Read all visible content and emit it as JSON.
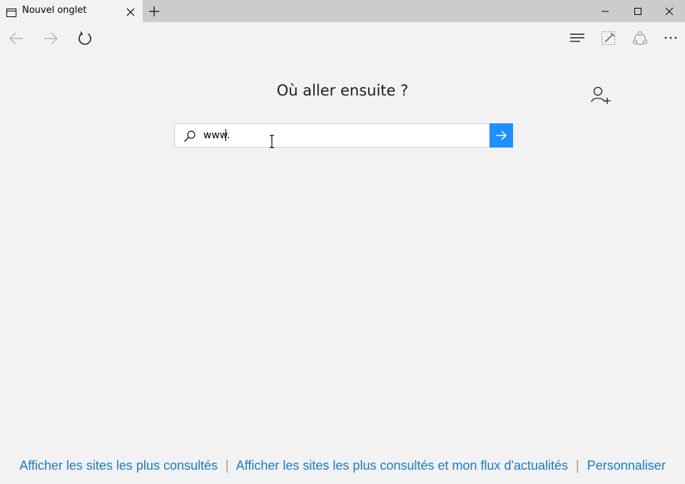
{
  "tab": {
    "title": "Nouvel onglet",
    "icon": "page-icon",
    "close_icon": "close-icon",
    "new_tab_icon": "plus-icon"
  },
  "window_controls": [
    "minimize-icon",
    "maximize-icon",
    "close-icon"
  ],
  "toolbar": {
    "left": [
      "back-arrow-icon",
      "forward-arrow-icon",
      "refresh-icon"
    ],
    "right": [
      "hub-icon",
      "web-note-icon",
      "share-icon",
      "more-icon"
    ]
  },
  "main": {
    "heading": "Où aller ensuite ?",
    "add_user_icon": "add-user-icon"
  },
  "search": {
    "value": "www.",
    "search_icon": "search-icon",
    "go_icon": "arrow-right-icon"
  },
  "footer": {
    "link1": "Afficher les sites les plus consultés",
    "link2": "Afficher les sites les plus consultés et mon flux d'actualités",
    "link3": "Personnaliser",
    "separator": "|"
  },
  "colors": {
    "accent": "#1e90ff",
    "link": "#1a7bc9",
    "background": "#f2f2f2",
    "titlebar": "#cccccc"
  }
}
